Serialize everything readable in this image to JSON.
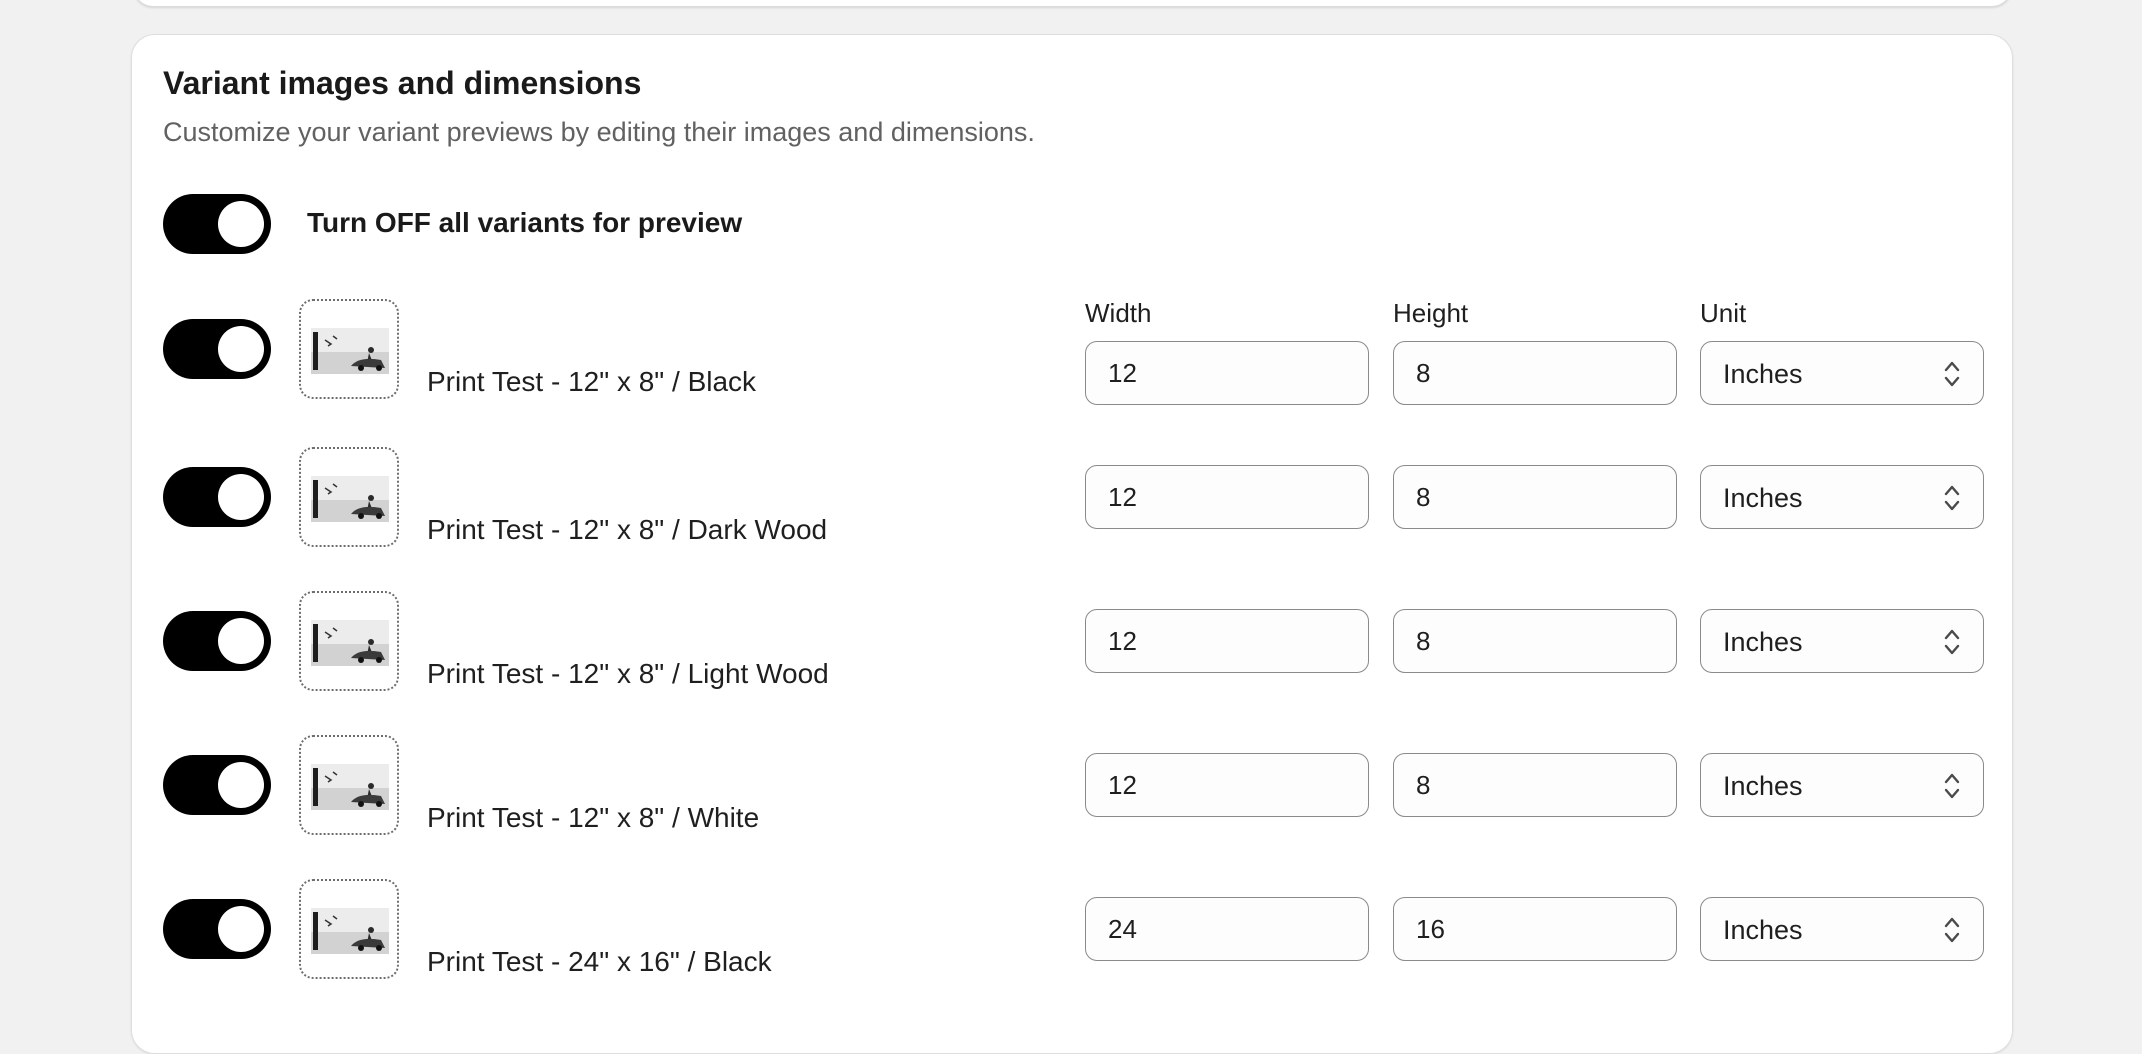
{
  "section": {
    "title": "Variant images and dimensions",
    "subtitle": "Customize your variant previews by editing their images and dimensions."
  },
  "master_toggle": {
    "label": "Turn OFF all variants for preview",
    "on": true
  },
  "columns": {
    "width": "Width",
    "height": "Height",
    "unit": "Unit"
  },
  "variants": [
    {
      "name": "Print Test - 12\" x 8\" / Black",
      "width": "12",
      "height": "8",
      "unit": "Inches",
      "enabled": true
    },
    {
      "name": "Print Test - 12\" x 8\" / Dark Wood",
      "width": "12",
      "height": "8",
      "unit": "Inches",
      "enabled": true
    },
    {
      "name": "Print Test - 12\" x 8\" / Light Wood",
      "width": "12",
      "height": "8",
      "unit": "Inches",
      "enabled": true
    },
    {
      "name": "Print Test - 12\" x 8\" / White",
      "width": "12",
      "height": "8",
      "unit": "Inches",
      "enabled": true
    },
    {
      "name": "Print Test - 24\" x 16\" / Black",
      "width": "24",
      "height": "16",
      "unit": "Inches",
      "enabled": true
    }
  ],
  "icons": {
    "thumbnail": "variant-image-thumbnail",
    "unit_select": "chevron-up-down-icon"
  },
  "colors": {
    "toggle_on": "#000000",
    "card_background": "#ffffff",
    "page_background": "#f1f1f1",
    "subtitle_text": "#616161"
  }
}
